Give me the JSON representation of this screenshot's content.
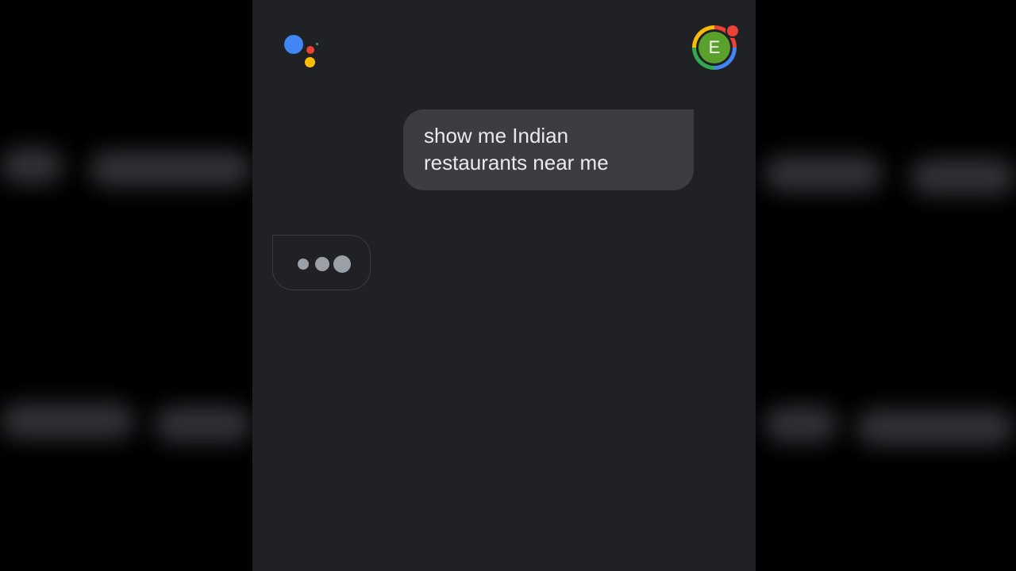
{
  "assistant": {
    "logo_icon": "google-assistant-icon",
    "colors": {
      "blue": "#4285f4",
      "red": "#ea4335",
      "yellow": "#fbbc04",
      "green": "#34a853"
    }
  },
  "user": {
    "avatar_initial": "E",
    "avatar_color": "#5aa02c",
    "notification_color": "#ea4335"
  },
  "conversation": {
    "user_message": "show me Indian restaurants near me",
    "assistant_status": "typing-indicator"
  },
  "theme": {
    "screen_background": "#202124",
    "user_bubble_background": "#3c3d42",
    "text_color": "#e8eaed"
  }
}
